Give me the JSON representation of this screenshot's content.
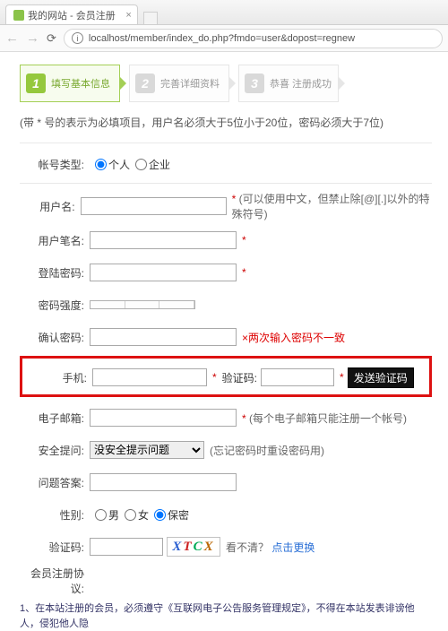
{
  "browser": {
    "tab_title": "我的网站 - 会员注册",
    "url": "localhost/member/index_do.php?fmdo=user&dopost=regnew"
  },
  "steps": {
    "s1": "填写基本信息",
    "s2": "完善详细资料",
    "s3": "恭喜 注册成功"
  },
  "hint": "(带 * 号的表示为必填项目，用户名必须大于5位小于20位，密码必须大于7位)",
  "labels": {
    "acct_type": "帐号类型:",
    "username": "用户名:",
    "nickname": "用户笔名:",
    "password": "登陆密码:",
    "pwd_strength": "密码强度:",
    "confirm_pwd": "确认密码:",
    "phone": "手机:",
    "vcode_sms": "验证码:",
    "email": "电子邮箱:",
    "question": "安全提问:",
    "answer": "问题答案:",
    "gender": "性别:",
    "captcha": "验证码:",
    "terms": "会员注册协议:"
  },
  "options": {
    "personal": "个人",
    "enterprise": "企业",
    "male": "男",
    "female": "女",
    "secret": "保密"
  },
  "notes": {
    "username_after": "(可以使用中文，但禁止除[@][.]以外的特殊符号)",
    "confirm_err": "×两次输入密码不一致",
    "email_after": "(每个电子邮箱只能注册一个帐号)",
    "question_after": "(忘记密码时重设密码用)",
    "captcha_prompt": "看不清？",
    "captcha_refresh": "点击更换"
  },
  "buttons": {
    "send_sms": "发送验证码"
  },
  "select": {
    "no_question": "没安全提示问题"
  },
  "captcha_text": {
    "a": "X",
    "b": "T",
    "c": "C",
    "d": "X"
  },
  "terms_body": "1、在本站注册的会员，必须遵守《互联网电子公告服务管理规定》，不得在本站发表诽谤他人，侵犯他人隐"
}
